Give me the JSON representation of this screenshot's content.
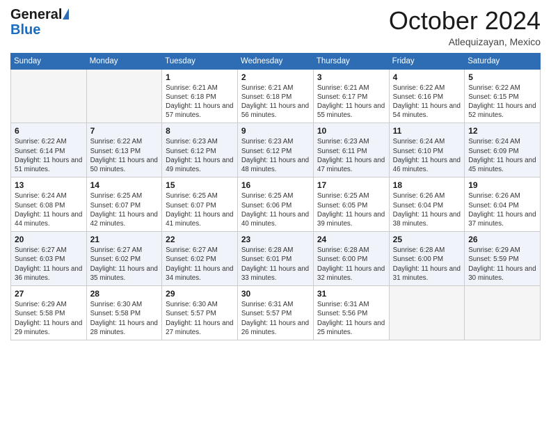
{
  "header": {
    "logo_general": "General",
    "logo_blue": "Blue",
    "month_title": "October 2024",
    "location": "Atlequizayan, Mexico"
  },
  "weekdays": [
    "Sunday",
    "Monday",
    "Tuesday",
    "Wednesday",
    "Thursday",
    "Friday",
    "Saturday"
  ],
  "weeks": [
    [
      {
        "day": "",
        "sunrise": "",
        "sunset": "",
        "daylight": ""
      },
      {
        "day": "",
        "sunrise": "",
        "sunset": "",
        "daylight": ""
      },
      {
        "day": "1",
        "sunrise": "Sunrise: 6:21 AM",
        "sunset": "Sunset: 6:18 PM",
        "daylight": "Daylight: 11 hours and 57 minutes."
      },
      {
        "day": "2",
        "sunrise": "Sunrise: 6:21 AM",
        "sunset": "Sunset: 6:18 PM",
        "daylight": "Daylight: 11 hours and 56 minutes."
      },
      {
        "day": "3",
        "sunrise": "Sunrise: 6:21 AM",
        "sunset": "Sunset: 6:17 PM",
        "daylight": "Daylight: 11 hours and 55 minutes."
      },
      {
        "day": "4",
        "sunrise": "Sunrise: 6:22 AM",
        "sunset": "Sunset: 6:16 PM",
        "daylight": "Daylight: 11 hours and 54 minutes."
      },
      {
        "day": "5",
        "sunrise": "Sunrise: 6:22 AM",
        "sunset": "Sunset: 6:15 PM",
        "daylight": "Daylight: 11 hours and 52 minutes."
      }
    ],
    [
      {
        "day": "6",
        "sunrise": "Sunrise: 6:22 AM",
        "sunset": "Sunset: 6:14 PM",
        "daylight": "Daylight: 11 hours and 51 minutes."
      },
      {
        "day": "7",
        "sunrise": "Sunrise: 6:22 AM",
        "sunset": "Sunset: 6:13 PM",
        "daylight": "Daylight: 11 hours and 50 minutes."
      },
      {
        "day": "8",
        "sunrise": "Sunrise: 6:23 AM",
        "sunset": "Sunset: 6:12 PM",
        "daylight": "Daylight: 11 hours and 49 minutes."
      },
      {
        "day": "9",
        "sunrise": "Sunrise: 6:23 AM",
        "sunset": "Sunset: 6:12 PM",
        "daylight": "Daylight: 11 hours and 48 minutes."
      },
      {
        "day": "10",
        "sunrise": "Sunrise: 6:23 AM",
        "sunset": "Sunset: 6:11 PM",
        "daylight": "Daylight: 11 hours and 47 minutes."
      },
      {
        "day": "11",
        "sunrise": "Sunrise: 6:24 AM",
        "sunset": "Sunset: 6:10 PM",
        "daylight": "Daylight: 11 hours and 46 minutes."
      },
      {
        "day": "12",
        "sunrise": "Sunrise: 6:24 AM",
        "sunset": "Sunset: 6:09 PM",
        "daylight": "Daylight: 11 hours and 45 minutes."
      }
    ],
    [
      {
        "day": "13",
        "sunrise": "Sunrise: 6:24 AM",
        "sunset": "Sunset: 6:08 PM",
        "daylight": "Daylight: 11 hours and 44 minutes."
      },
      {
        "day": "14",
        "sunrise": "Sunrise: 6:25 AM",
        "sunset": "Sunset: 6:07 PM",
        "daylight": "Daylight: 11 hours and 42 minutes."
      },
      {
        "day": "15",
        "sunrise": "Sunrise: 6:25 AM",
        "sunset": "Sunset: 6:07 PM",
        "daylight": "Daylight: 11 hours and 41 minutes."
      },
      {
        "day": "16",
        "sunrise": "Sunrise: 6:25 AM",
        "sunset": "Sunset: 6:06 PM",
        "daylight": "Daylight: 11 hours and 40 minutes."
      },
      {
        "day": "17",
        "sunrise": "Sunrise: 6:25 AM",
        "sunset": "Sunset: 6:05 PM",
        "daylight": "Daylight: 11 hours and 39 minutes."
      },
      {
        "day": "18",
        "sunrise": "Sunrise: 6:26 AM",
        "sunset": "Sunset: 6:04 PM",
        "daylight": "Daylight: 11 hours and 38 minutes."
      },
      {
        "day": "19",
        "sunrise": "Sunrise: 6:26 AM",
        "sunset": "Sunset: 6:04 PM",
        "daylight": "Daylight: 11 hours and 37 minutes."
      }
    ],
    [
      {
        "day": "20",
        "sunrise": "Sunrise: 6:27 AM",
        "sunset": "Sunset: 6:03 PM",
        "daylight": "Daylight: 11 hours and 36 minutes."
      },
      {
        "day": "21",
        "sunrise": "Sunrise: 6:27 AM",
        "sunset": "Sunset: 6:02 PM",
        "daylight": "Daylight: 11 hours and 35 minutes."
      },
      {
        "day": "22",
        "sunrise": "Sunrise: 6:27 AM",
        "sunset": "Sunset: 6:02 PM",
        "daylight": "Daylight: 11 hours and 34 minutes."
      },
      {
        "day": "23",
        "sunrise": "Sunrise: 6:28 AM",
        "sunset": "Sunset: 6:01 PM",
        "daylight": "Daylight: 11 hours and 33 minutes."
      },
      {
        "day": "24",
        "sunrise": "Sunrise: 6:28 AM",
        "sunset": "Sunset: 6:00 PM",
        "daylight": "Daylight: 11 hours and 32 minutes."
      },
      {
        "day": "25",
        "sunrise": "Sunrise: 6:28 AM",
        "sunset": "Sunset: 6:00 PM",
        "daylight": "Daylight: 11 hours and 31 minutes."
      },
      {
        "day": "26",
        "sunrise": "Sunrise: 6:29 AM",
        "sunset": "Sunset: 5:59 PM",
        "daylight": "Daylight: 11 hours and 30 minutes."
      }
    ],
    [
      {
        "day": "27",
        "sunrise": "Sunrise: 6:29 AM",
        "sunset": "Sunset: 5:58 PM",
        "daylight": "Daylight: 11 hours and 29 minutes."
      },
      {
        "day": "28",
        "sunrise": "Sunrise: 6:30 AM",
        "sunset": "Sunset: 5:58 PM",
        "daylight": "Daylight: 11 hours and 28 minutes."
      },
      {
        "day": "29",
        "sunrise": "Sunrise: 6:30 AM",
        "sunset": "Sunset: 5:57 PM",
        "daylight": "Daylight: 11 hours and 27 minutes."
      },
      {
        "day": "30",
        "sunrise": "Sunrise: 6:31 AM",
        "sunset": "Sunset: 5:57 PM",
        "daylight": "Daylight: 11 hours and 26 minutes."
      },
      {
        "day": "31",
        "sunrise": "Sunrise: 6:31 AM",
        "sunset": "Sunset: 5:56 PM",
        "daylight": "Daylight: 11 hours and 25 minutes."
      },
      {
        "day": "",
        "sunrise": "",
        "sunset": "",
        "daylight": ""
      },
      {
        "day": "",
        "sunrise": "",
        "sunset": "",
        "daylight": ""
      }
    ]
  ]
}
